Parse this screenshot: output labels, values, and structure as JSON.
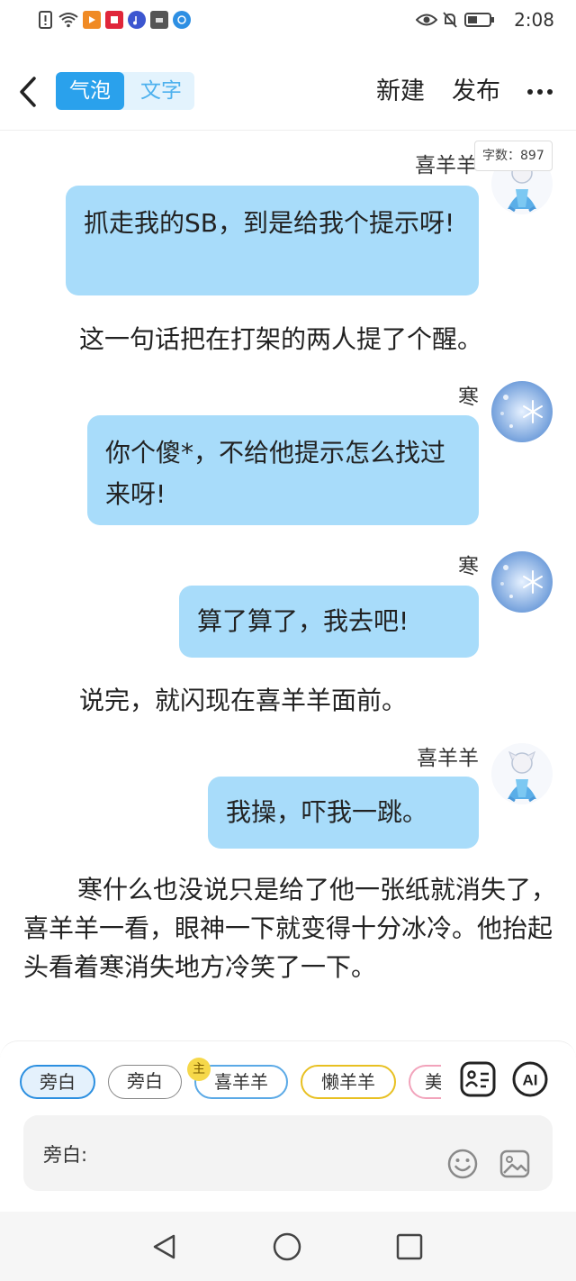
{
  "status_bar": {
    "time": "2:08",
    "left_icons": [
      "alert-icon",
      "wifi-icon",
      "video-app-icon",
      "book-app-icon",
      "music-app-icon",
      "huawei-app-icon",
      "browser-app-icon"
    ],
    "right_icons": [
      "eye-icon",
      "mute-icon",
      "battery-icon"
    ]
  },
  "header": {
    "tab_bubble": "气泡",
    "tab_text": "文字",
    "new_label": "新建",
    "publish_label": "发布"
  },
  "word_count": "字数：897",
  "messages": [
    {
      "type": "bubble",
      "speaker": "喜羊羊",
      "text": "抓走我的SB，到是给我个提示呀!"
    },
    {
      "type": "narration",
      "text": "这一句话把在打架的两人提了个醒。"
    },
    {
      "type": "bubble",
      "speaker": "寒",
      "text": "你个傻*，不给他提示怎么找过来呀!"
    },
    {
      "type": "bubble",
      "speaker": "寒",
      "text": "算了算了，我去吧!"
    },
    {
      "type": "narration",
      "text": "说完，就闪现在喜羊羊面前。"
    },
    {
      "type": "bubble",
      "speaker": "喜羊羊",
      "text": "我操，吓我一跳。"
    },
    {
      "type": "narration",
      "text": "寒什么也没说只是给了他一张纸就消失了，喜羊羊一看，眼神一下就变得十分冰冷。他抬起头看着寒消失地方冷笑了一下。"
    }
  ],
  "toolbar": {
    "chips": [
      "旁白",
      "旁白",
      "喜羊羊",
      "懒羊羊",
      "美"
    ],
    "main_badge": "主",
    "input_label": "旁白:",
    "ai_label": "AI"
  },
  "colors": {
    "accent": "#2aa1ec",
    "bubble": "#a8dcfa",
    "chip_selected_border": "#2b8fe0",
    "chip_blue_border": "#5aa9e6",
    "chip_yellow_border": "#e8c021",
    "chip_pink_border": "#f2a3bb"
  }
}
